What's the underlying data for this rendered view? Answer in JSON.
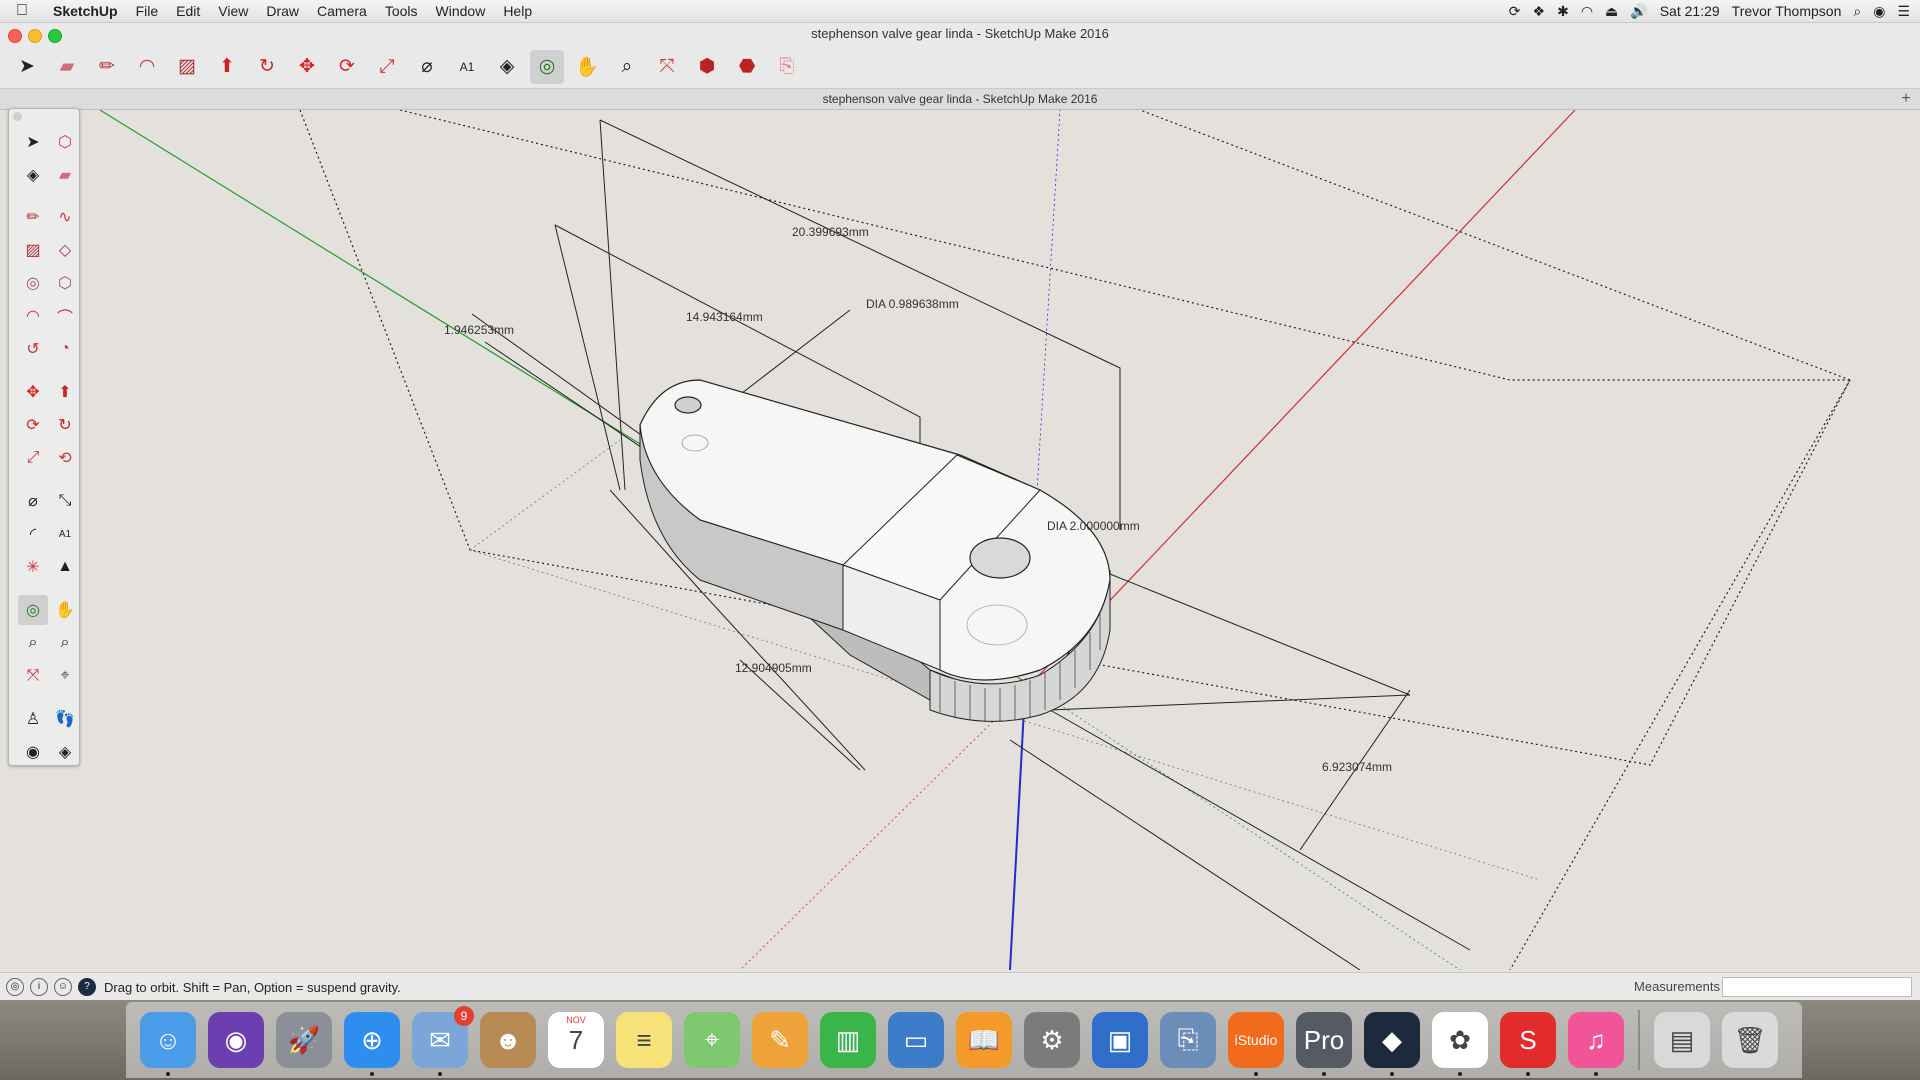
{
  "menubar": {
    "app_name": "SketchUp",
    "items": [
      "File",
      "Edit",
      "View",
      "Draw",
      "Camera",
      "Tools",
      "Window",
      "Help"
    ],
    "clock": "Sat 21:29",
    "user": "Trevor Thompson"
  },
  "window": {
    "title": "stephenson valve gear linda - SketchUp Make 2016",
    "document_title": "stephenson valve gear linda - SketchUp Make 2016"
  },
  "toolbar": {
    "icons": [
      "select-icon",
      "eraser-icon",
      "pencil-icon",
      "arc-icon",
      "rectangle-icon",
      "push-pull-icon",
      "follow-me-icon",
      "move-icon",
      "rotate-icon",
      "scale-icon",
      "tape-measure-icon",
      "text-icon",
      "paint-bucket-icon",
      "orbit-icon",
      "pan-icon",
      "zoom-icon",
      "zoom-extents-icon",
      "warehouse-icon",
      "extension-icon",
      "send-to-layout-icon"
    ],
    "active": "orbit-icon"
  },
  "palette": {
    "icons": [
      "select-icon",
      "component-icon",
      "paint-icon",
      "eraser-icon",
      "line-icon",
      "freehand-icon",
      "rectangle-icon",
      "rotated-rectangle-icon",
      "circle-icon",
      "polygon-icon",
      "arc-icon",
      "two-point-arc-icon",
      "three-point-arc-icon",
      "pie-icon",
      "move-icon",
      "push-pull-icon",
      "rotate-icon",
      "follow-me-icon",
      "scale-icon",
      "offset-icon",
      "tape-measure-icon",
      "dimension-icon",
      "protractor-icon",
      "text-icon",
      "axes-icon",
      "3d-text-icon",
      "orbit-icon",
      "pan-icon",
      "zoom-icon",
      "zoom-window-icon",
      "zoom-extents-icon",
      "previous-icon",
      "position-camera-icon",
      "walk-icon",
      "look-around-icon",
      "section-plane-icon"
    ],
    "active": "orbit-icon"
  },
  "model": {
    "dimensions": [
      {
        "label": "20.399693mm"
      },
      {
        "label": "DIA 0.989638mm"
      },
      {
        "label": "14.943164mm"
      },
      {
        "label": "1.946253mm"
      },
      {
        "label": "DIA 2.000000mm"
      },
      {
        "label": "12.904905mm"
      },
      {
        "label": "6.923074mm"
      }
    ],
    "axis_colors": {
      "red": "#d8292a",
      "green": "#1f9e2a",
      "blue": "#1d2ec9"
    }
  },
  "statusbar": {
    "message": "Drag to orbit. Shift = Pan, Option = suspend gravity.",
    "measurements_label": "Measurements",
    "measurements_value": ""
  },
  "dock": {
    "apps": [
      {
        "name": "finder",
        "color": "#4a9be8",
        "glyph": "☺"
      },
      {
        "name": "siri",
        "color": "#6b3fb0",
        "glyph": "◉"
      },
      {
        "name": "launchpad",
        "color": "#8a8f98",
        "glyph": "🚀"
      },
      {
        "name": "safari",
        "color": "#2d8ef0",
        "glyph": "⊕"
      },
      {
        "name": "mail-bird",
        "color": "#7da6d8",
        "glyph": "✉",
        "badge": "9"
      },
      {
        "name": "contacts",
        "color": "#b88a54",
        "glyph": "☻"
      },
      {
        "name": "calendar",
        "color": "#ffffff",
        "glyph": "7",
        "month": "NOV"
      },
      {
        "name": "notes",
        "color": "#f7e27a",
        "glyph": "≡"
      },
      {
        "name": "maps",
        "color": "#7ec86f",
        "glyph": "⌖"
      },
      {
        "name": "pages",
        "color": "#f0a23a",
        "glyph": "✎"
      },
      {
        "name": "numbers",
        "color": "#39b54a",
        "glyph": "▥"
      },
      {
        "name": "keynote",
        "color": "#3d7cc9",
        "glyph": "▭"
      },
      {
        "name": "ibooks",
        "color": "#f39a2b",
        "glyph": "📖"
      },
      {
        "name": "system-preferences",
        "color": "#7b7b7b",
        "glyph": "⚙"
      },
      {
        "name": "remote-desktop",
        "color": "#2f6fc7",
        "glyph": "▣"
      },
      {
        "name": "preview",
        "color": "#6c8db8",
        "glyph": "⎘"
      },
      {
        "name": "istudio",
        "color": "#f26a1c",
        "glyph": "iStudio"
      },
      {
        "name": "google-earth-pro",
        "color": "#555a63",
        "glyph": "Pro"
      },
      {
        "name": "arrow-app",
        "color": "#1c2a3d",
        "glyph": "◆"
      },
      {
        "name": "photos",
        "color": "#ffffff",
        "glyph": "✿"
      },
      {
        "name": "sketchup",
        "color": "#e32b2b",
        "glyph": "S"
      },
      {
        "name": "itunes",
        "color": "#f25597",
        "glyph": "♫"
      },
      {
        "name": "downloads-stack",
        "color": "#d9d9d9",
        "glyph": "▤"
      },
      {
        "name": "trash",
        "color": "#d9dadb",
        "glyph": "🗑"
      }
    ]
  }
}
